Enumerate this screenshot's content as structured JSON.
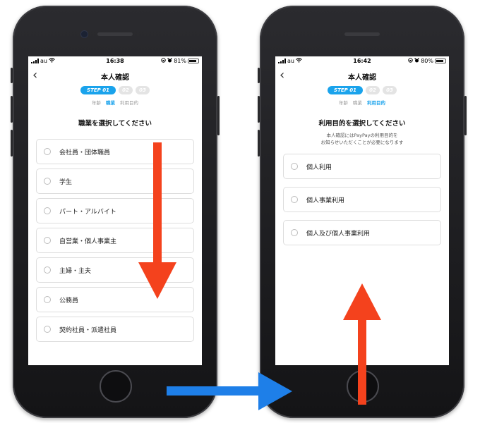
{
  "left_phone": {
    "status": {
      "carrier": "au",
      "time": "16:38",
      "battery": "81%",
      "battery_level": 0.81
    },
    "nav": {
      "back": "‹",
      "title": "本人確認"
    },
    "steps": [
      "STEP 01",
      "02",
      "03"
    ],
    "substeps": [
      "年齢",
      "職業",
      "利用目的"
    ],
    "active_substep": "職業",
    "heading": "職業を選択してください",
    "options": [
      "会社員・団体職員",
      "学生",
      "パート・アルバイト",
      "自営業・個人事業主",
      "主婦・主夫",
      "公務員",
      "契約社員・派遣社員"
    ]
  },
  "right_phone": {
    "status": {
      "carrier": "au",
      "time": "16:42",
      "battery": "80%",
      "battery_level": 0.8
    },
    "nav": {
      "back": "‹",
      "title": "本人確認"
    },
    "steps": [
      "STEP 01",
      "02",
      "03"
    ],
    "substeps": [
      "年齢",
      "職業",
      "利用目的"
    ],
    "active_substep": "利用目的",
    "heading": "利用目的を選択してください",
    "note_lines": [
      "本人確認にはPayPayの利用目的を",
      "お知らせいただくことが必要になります"
    ],
    "options": [
      "個人利用",
      "個人事業利用",
      "個人及び個人事業利用"
    ]
  },
  "colors": {
    "accent": "#1aa3ec",
    "annotation_red": "#f4421d",
    "annotation_blue": "#1e7fe8"
  },
  "icons": [
    "back-chevron-icon",
    "signal-icon",
    "wifi-icon",
    "lock-rotation-icon",
    "alarm-icon",
    "battery-icon",
    "radio-button-icon",
    "down-arrow-icon",
    "up-arrow-icon",
    "right-arrow-icon"
  ]
}
